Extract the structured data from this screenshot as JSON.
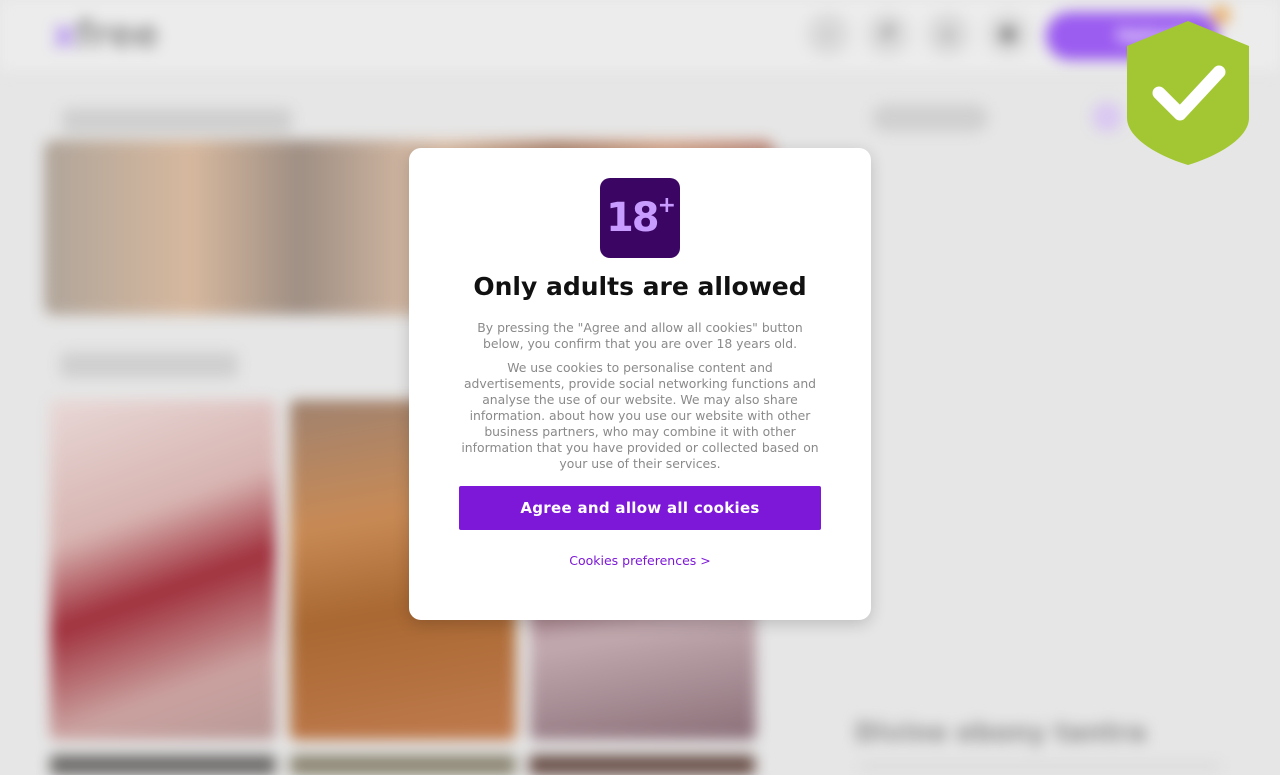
{
  "site": {
    "logo_text_a": "x",
    "logo_text_b": "free"
  },
  "header": {
    "icons": [
      "search-icon",
      "hashtag-icon",
      "home-icon",
      "user-icon"
    ],
    "upload_label": "Upload",
    "coin_label": "$"
  },
  "sidebar": {
    "promo_title": "Divine ebony tantra"
  },
  "age_modal": {
    "badge_text": "18",
    "badge_sup": "+",
    "title": "Only adults are allowed",
    "paragraph_1": "By pressing the \"Agree and allow all cookies\" button below, you confirm that you are over 18 years old.",
    "paragraph_2": "We use cookies to personalise content and advertisements, provide social networking functions and analyse the use of our website. We may also share information. about how you use our website with other business partners, who may combine it with other information that you have provided or collected based on your use of their services.",
    "agree_button": "Agree and allow all cookies",
    "preferences_link": "Cookies preferences >"
  },
  "colors": {
    "accent": "#7d18d8",
    "badge_bg": "#3b0663",
    "shield": "#a2c732"
  }
}
